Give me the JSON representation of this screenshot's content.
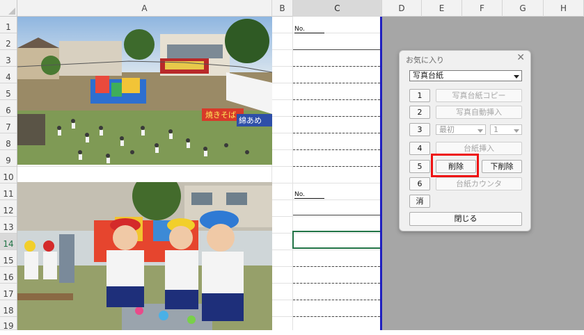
{
  "columns": [
    {
      "label": "A",
      "selected": false
    },
    {
      "label": "B",
      "selected": false
    },
    {
      "label": "C",
      "selected": true
    },
    {
      "label": "D",
      "selected": false
    },
    {
      "label": "E",
      "selected": false
    },
    {
      "label": "F",
      "selected": false
    },
    {
      "label": "G",
      "selected": false
    },
    {
      "label": "H",
      "selected": false
    }
  ],
  "rows": [
    "1",
    "2",
    "3",
    "4",
    "5",
    "6",
    "7",
    "8",
    "9",
    "10",
    "11",
    "12",
    "13",
    "14",
    "15",
    "16",
    "17",
    "18",
    "19"
  ],
  "selected_row": "14",
  "sheet": {
    "no_label_top": "No.",
    "no_label_bottom": "No."
  },
  "photos": {
    "top": {
      "banner_left": "焼きそば",
      "banner_right": "綿あめ"
    },
    "bottom": {}
  },
  "dialog": {
    "title": "お気に入り",
    "close": "✕",
    "dropdown_value": "写真台紙",
    "buttons": [
      {
        "num": "1",
        "label": "写真台紙コピー",
        "enabled": false
      },
      {
        "num": "2",
        "label": "写真自動挿入",
        "enabled": false
      },
      {
        "num": "3",
        "combo1": "最初",
        "combo2": "1",
        "enabled": false
      },
      {
        "num": "4",
        "label": "台紙挿入",
        "enabled": false
      },
      {
        "num": "5",
        "label": "削除",
        "label2": "下削除",
        "enabled": true
      },
      {
        "num": "6",
        "label": "台紙カウンタ",
        "enabled": false
      }
    ],
    "erase": "消",
    "close_button": "閉じる"
  },
  "colors": {
    "highlight": "#ee1111",
    "selection": "#217346",
    "print_border": "#1f1fbf"
  }
}
